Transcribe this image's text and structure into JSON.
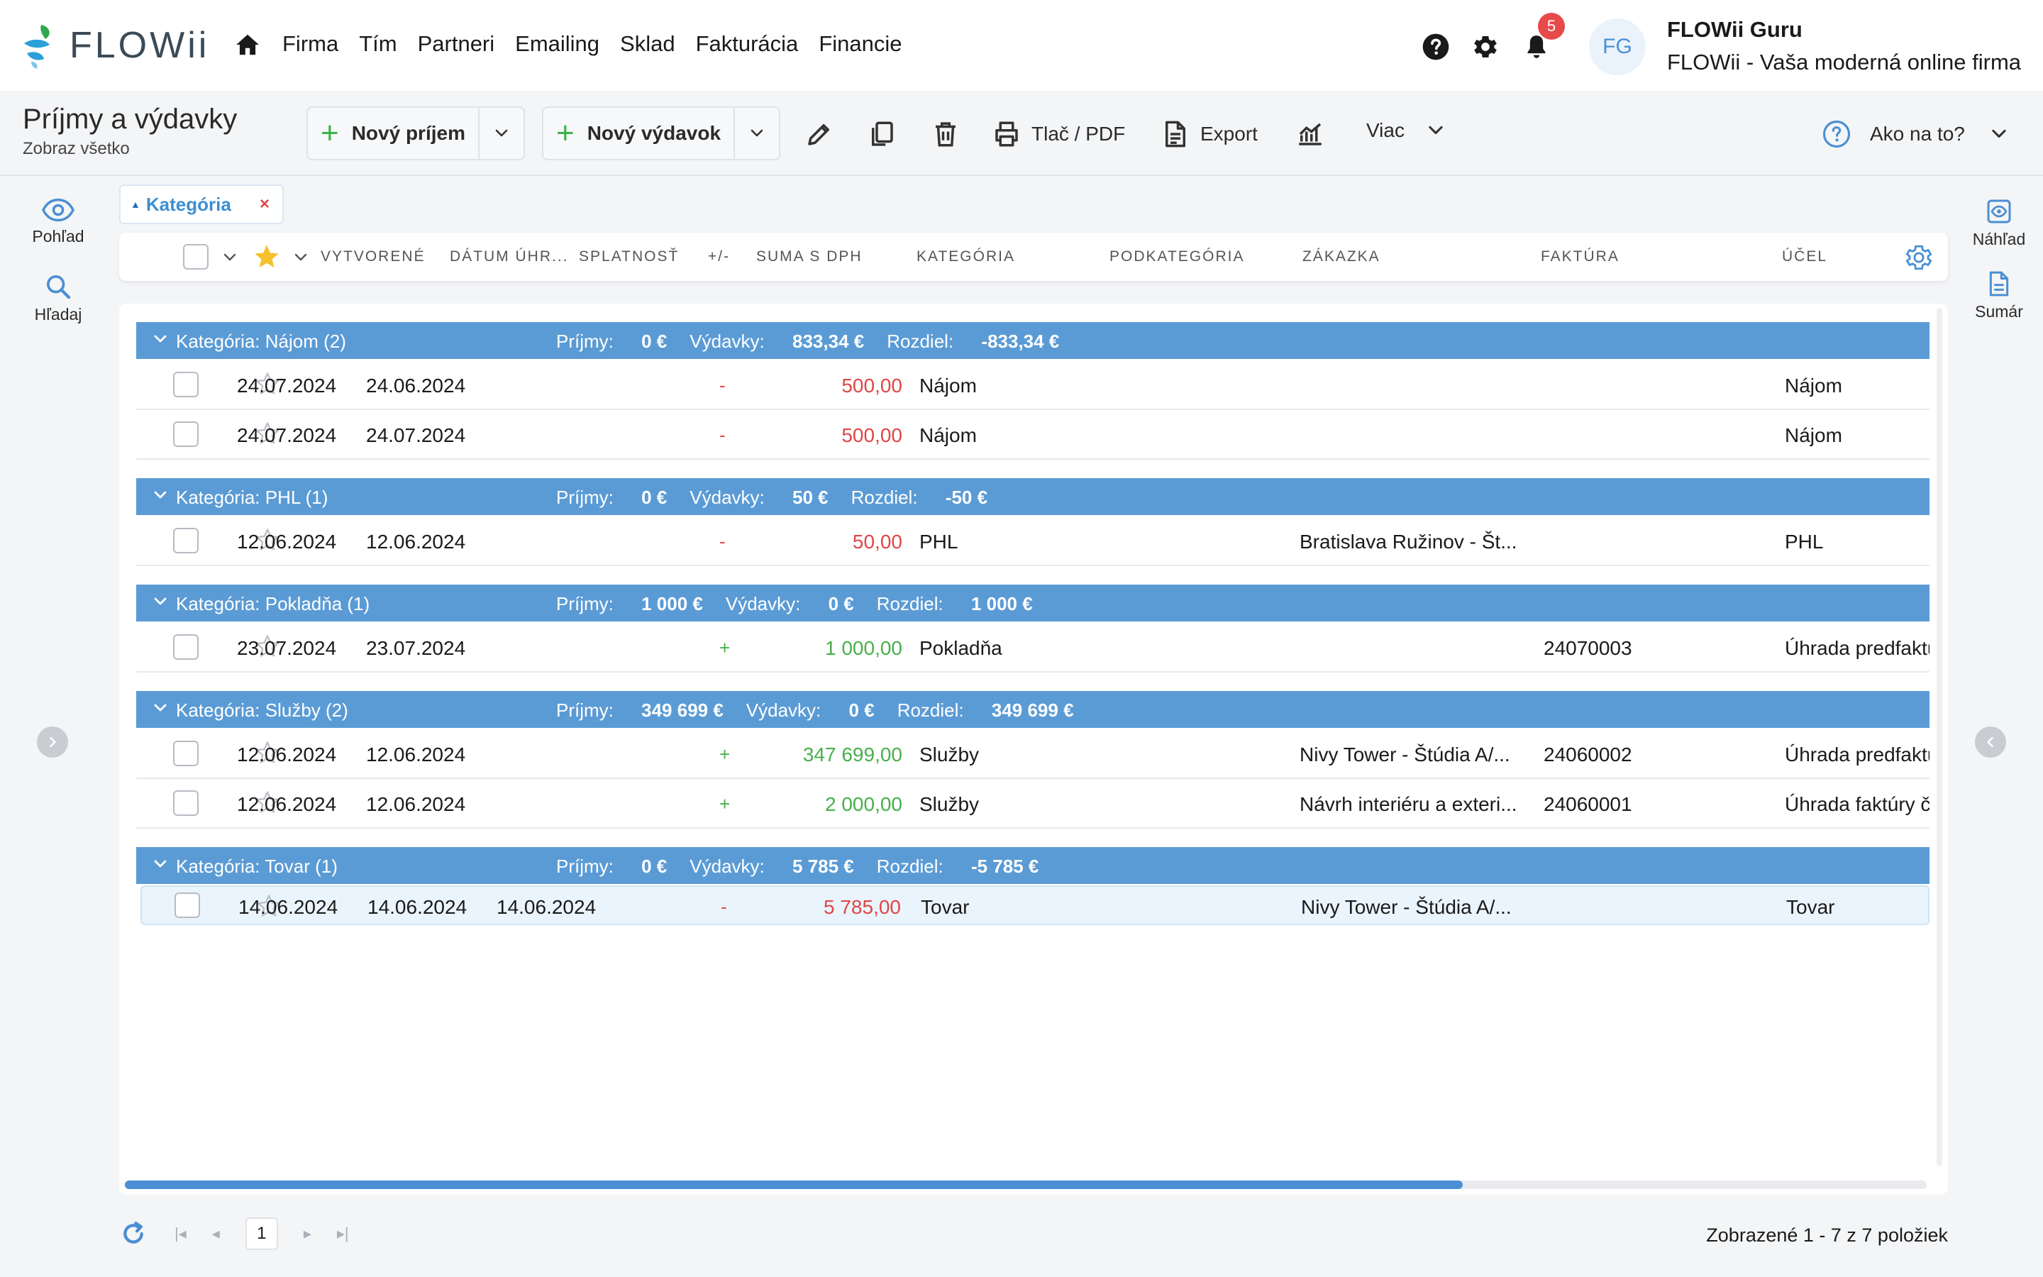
{
  "app": {
    "logo_text": "FLOWii",
    "nav": [
      "Firma",
      "Tím",
      "Partneri",
      "Emailing",
      "Sklad",
      "Fakturácia",
      "Financie"
    ],
    "notifications_count": "5",
    "avatar_initials": "FG",
    "user_name": "FLOWii Guru",
    "user_company": "FLOWii - Vaša moderná online firma"
  },
  "toolbar": {
    "title": "Príjmy a výdavky",
    "subtitle": "Zobraz všetko",
    "new_income": "Nový príjem",
    "new_expense": "Nový výdavok",
    "print_label": "Tlač / PDF",
    "export_label": "Export",
    "more_label": "Viac",
    "help_label": "Ako na to?"
  },
  "left_rail": {
    "view": "Pohľad",
    "search": "Hľadaj"
  },
  "right_rail": {
    "preview": "Náhľad",
    "summary": "Sumár"
  },
  "filter_chip": {
    "label": "Kategória",
    "remove": "×"
  },
  "columns": {
    "created": "VYTVORENÉ",
    "paid": "DÁTUM ÚHR...",
    "due": "SPLATNOSŤ",
    "sign": "+/-",
    "amount": "SUMA S DPH",
    "category": "KATEGÓRIA",
    "subcategory": "PODKATEGÓRIA",
    "order": "ZÁKAZKA",
    "invoice": "FAKTÚRA",
    "purpose": "ÚČEL"
  },
  "labels": {
    "income": "Príjmy:",
    "expense": "Výdavky:",
    "diff": "Rozdiel:"
  },
  "groups": [
    {
      "name": "Kategória: Nájom (2)",
      "income": "0 €",
      "expense": "833,34 €",
      "diff": "-833,34 €",
      "rows": [
        {
          "created": "24.07.2024",
          "paid": "24.06.2024",
          "due": "",
          "sign": "-",
          "amount": "500,00",
          "type": "neg",
          "category": "Nájom",
          "order": "",
          "invoice": "",
          "purpose": "Nájom"
        },
        {
          "created": "24.07.2024",
          "paid": "24.07.2024",
          "due": "",
          "sign": "-",
          "amount": "500,00",
          "type": "neg",
          "category": "Nájom",
          "order": "",
          "invoice": "",
          "purpose": "Nájom"
        }
      ]
    },
    {
      "name": "Kategória: PHL (1)",
      "income": "0 €",
      "expense": "50 €",
      "diff": "-50 €",
      "rows": [
        {
          "created": "12.06.2024",
          "paid": "12.06.2024",
          "due": "",
          "sign": "-",
          "amount": "50,00",
          "type": "neg",
          "category": "PHL",
          "order": "Bratislava Ružinov - Št...",
          "invoice": "",
          "purpose": "PHL"
        }
      ]
    },
    {
      "name": "Kategória: Pokladňa (1)",
      "income": "1 000 €",
      "expense": "0 €",
      "diff": "1 000 €",
      "rows": [
        {
          "created": "23.07.2024",
          "paid": "23.07.2024",
          "due": "",
          "sign": "+",
          "amount": "1 000,00",
          "type": "pos",
          "category": "Pokladňa",
          "order": "",
          "invoice": "24070003",
          "purpose": "Úhrada predfaktúry"
        }
      ]
    },
    {
      "name": "Kategória: Služby (2)",
      "income": "349 699 €",
      "expense": "0 €",
      "diff": "349 699 €",
      "rows": [
        {
          "created": "12.06.2024",
          "paid": "12.06.2024",
          "due": "",
          "sign": "+",
          "amount": "347 699,00",
          "type": "pos",
          "category": "Služby",
          "order": "Nivy Tower - Štúdia A/...",
          "invoice": "24060002",
          "purpose": "Úhrada predfaktúry"
        },
        {
          "created": "12.06.2024",
          "paid": "12.06.2024",
          "due": "",
          "sign": "+",
          "amount": "2 000,00",
          "type": "pos",
          "category": "Služby",
          "order": "Návrh interiéru a exteri...",
          "invoice": "24060001",
          "purpose": "Úhrada faktúry č"
        }
      ]
    },
    {
      "name": "Kategória: Tovar (1)",
      "income": "0 €",
      "expense": "5 785 €",
      "diff": "-5 785 €",
      "rows": [
        {
          "created": "14.06.2024",
          "paid": "14.06.2024",
          "due": "14.06.2024",
          "sign": "-",
          "amount": "5 785,00",
          "type": "neg",
          "category": "Tovar",
          "order": "Nivy Tower - Štúdia A/...",
          "invoice": "",
          "purpose": "Tovar"
        }
      ]
    }
  ],
  "footer": {
    "page": "1",
    "info": "Zobrazené 1 - 7 z 7 položiek"
  },
  "colors": {
    "group_bg": "#5b9bd5",
    "negative": "#e04646",
    "positive": "#48b04a",
    "accent": "#4a8fd4"
  }
}
